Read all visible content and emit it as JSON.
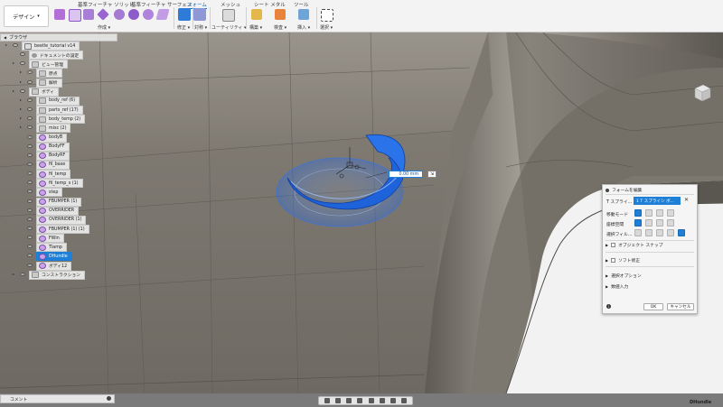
{
  "ribbon": {
    "workspace": "デザイン",
    "tabs": [
      {
        "label": "基準フィーチャ ソリッド",
        "active": false
      },
      {
        "label": "基準フィーチャ サーフェス",
        "active": false
      },
      {
        "label": "フォーム",
        "active": true
      },
      {
        "label": "メッシュ",
        "active": false
      },
      {
        "label": "シート メタル",
        "active": false
      },
      {
        "label": "ツール",
        "active": false
      }
    ],
    "groups": [
      "作成 ▾",
      "修正 ▾",
      "対称 ▾",
      "ユーティリティ ▾",
      "構築 ▾",
      "検査 ▾",
      "挿入 ▾",
      "選択 ▾"
    ]
  },
  "browser": {
    "header": "ブラウザ",
    "items": [
      {
        "label": "beetle_tutorial v14",
        "type": "doc",
        "indent": 0
      },
      {
        "label": "ドキュメントの設定",
        "type": "gear",
        "indent": 1
      },
      {
        "label": "ビュー管理",
        "type": "folder",
        "indent": 1
      },
      {
        "label": "原点",
        "type": "folder",
        "indent": 2
      },
      {
        "label": "解析",
        "type": "folder",
        "indent": 2
      },
      {
        "label": "ボディ",
        "type": "folder",
        "indent": 1
      },
      {
        "label": "body_ref (6)",
        "type": "folder",
        "indent": 2
      },
      {
        "label": "parts_ref (17)",
        "type": "folder",
        "indent": 2
      },
      {
        "label": "body_temp (2)",
        "type": "folder",
        "indent": 2
      },
      {
        "label": "misc (2)",
        "type": "folder",
        "indent": 2
      },
      {
        "label": "bodyB",
        "type": "body",
        "indent": 2
      },
      {
        "label": "BodyFF",
        "type": "body",
        "indent": 2
      },
      {
        "label": "BodyRF",
        "type": "body",
        "indent": 2
      },
      {
        "label": "fil_base",
        "type": "body",
        "indent": 2
      },
      {
        "label": "fil_temp",
        "type": "body",
        "indent": 2
      },
      {
        "label": "fil_temp_s (1)",
        "type": "body",
        "indent": 2
      },
      {
        "label": "step",
        "type": "body",
        "indent": 2
      },
      {
        "label": "FBUMPER (1)",
        "type": "body",
        "indent": 2
      },
      {
        "label": "OVERRIDER",
        "type": "body",
        "indent": 2
      },
      {
        "label": "OVERRIDER (1)",
        "type": "body",
        "indent": 2
      },
      {
        "label": "FBUMPER (1) (1)",
        "type": "body",
        "indent": 2
      },
      {
        "label": "FWin",
        "type": "body",
        "indent": 2
      },
      {
        "label": "Tlamp",
        "type": "body",
        "indent": 2
      },
      {
        "label": "DHundle",
        "type": "body",
        "indent": 2,
        "selected": true
      },
      {
        "label": "ボディ12",
        "type": "body",
        "indent": 2
      },
      {
        "label": "コンストラクション",
        "type": "folder",
        "indent": 1
      }
    ]
  },
  "dimension_input": {
    "value": "0.00 mm"
  },
  "form_dialog": {
    "title": "フォームを編集",
    "tspline_label": "T スプライ...",
    "tspline_value": "1 T スプライン ボ...",
    "move_mode_label": "移動モード",
    "coord_space_label": "座標空間",
    "selection_filter_label": "選択フィル...",
    "object_snap": "オブジェクト スナップ",
    "soft_modify": "ソフト修正",
    "selection_options": "選択オプション",
    "numeric_input": "数値入力",
    "ok": "OK",
    "cancel": "キャンセル"
  },
  "bottom": {
    "comments": "コメント",
    "status": "DHundle"
  },
  "colors": {
    "accent": "#1e7fd6",
    "selected_body": "#1f6fe0",
    "car_body": "#777066"
  }
}
